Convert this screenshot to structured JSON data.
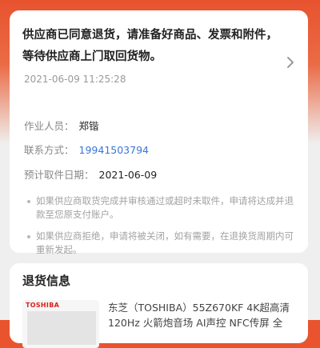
{
  "status": {
    "title": "供应商已同意退货，请准备好商品、发票和附件，等待供应商上门取回货物。",
    "time": "2021-06-09 11:25:28"
  },
  "pickup": {
    "worker_label": "作业人员：",
    "worker_value": "郑锴",
    "phone_label": "联系方式：",
    "phone_value": "19941503794",
    "date_label": "预计取件日期：",
    "date_value": "2021-06-09"
  },
  "notes": [
    "如果供应商取货完成并审核通过或超时未取件，申请将达成并退款至您原支付账户。",
    "如果供应商拒绝，申请将被关闭，如有需要，在退换货周期内可重新发起。"
  ],
  "return_info": {
    "title": "退货信息",
    "product": {
      "brand_logo_text": "TOSHIBA",
      "name": "东芝（TOSHIBA）55Z670KF 4K超高清 120Hz 火箭炮音场 AI声控 NFC传屏 全"
    }
  },
  "icons": {
    "chevron": "chevron-right-icon"
  },
  "colors": {
    "brand": "#e8532f",
    "link": "#3b76d6"
  }
}
